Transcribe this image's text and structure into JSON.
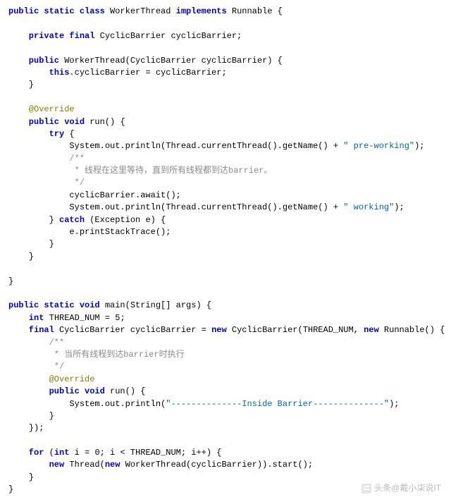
{
  "code": {
    "l1a": "public static class",
    "l1b": " WorkerThread ",
    "l1c": "implements",
    "l1d": " Runnable {",
    "l2": "",
    "l3a": "    private final",
    "l3b": " CyclicBarrier cyclicBarrier;",
    "l4": "",
    "l5a": "    public",
    "l5b": " WorkerThread(CyclicBarrier cyclicBarrier) {",
    "l6a": "        this",
    "l6b": ".cyclicBarrier = cyclicBarrier;",
    "l7": "    }",
    "l8": "",
    "l9": "    @Override",
    "l10a": "    public void",
    "l10b": " run() {",
    "l11a": "        try",
    "l11b": " {",
    "l12a": "            System.out.println(Thread.currentThread().getName() + ",
    "l12b": "\" pre-working\"",
    "l12c": ");",
    "l13": "            /**",
    "l14": "             * 线程在这里等待，直到所有线程都到达barrier。",
    "l15": "             */",
    "l16": "            cyclicBarrier.await();",
    "l17a": "            System.out.println(Thread.currentThread().getName() + ",
    "l17b": "\" working\"",
    "l17c": ");",
    "l18a": "        } ",
    "l18b": "catch",
    "l18c": " (Exception e) {",
    "l19": "            e.printStackTrace();",
    "l20": "        }",
    "l21": "    }",
    "l22": "",
    "l23": "}",
    "l24": "",
    "l25a": "public static void",
    "l25b": " main(String[] args) {",
    "l26a": "    int",
    "l26b": " THREAD_NUM = 5;",
    "l27a": "    final",
    "l27b": " CyclicBarrier cyclicBarrier = ",
    "l27c": "new",
    "l27d": " CyclicBarrier(THREAD_NUM, ",
    "l27e": "new",
    "l27f": " Runnable() {",
    "l28": "        /**",
    "l29": "         * 当所有线程到达barrier时执行",
    "l30": "         */",
    "l31": "        @Override",
    "l32a": "        public void",
    "l32b": " run() {",
    "l33a": "            System.out.println(",
    "l33b": "\"--------------Inside Barrier--------------\"",
    "l33c": ");",
    "l34": "        }",
    "l35": "    });",
    "l36": "",
    "l37a": "    for",
    "l37b": " (",
    "l37c": "int",
    "l37d": " i = 0; i < THREAD_NUM; i++) {",
    "l38a": "        new",
    "l38b": " Thread(",
    "l38c": "new",
    "l38d": " WorkerThread(cyclicBarrier)).start();",
    "l39": "    }",
    "l40": "}"
  },
  "watermark": "头条@戴小柒说IT"
}
